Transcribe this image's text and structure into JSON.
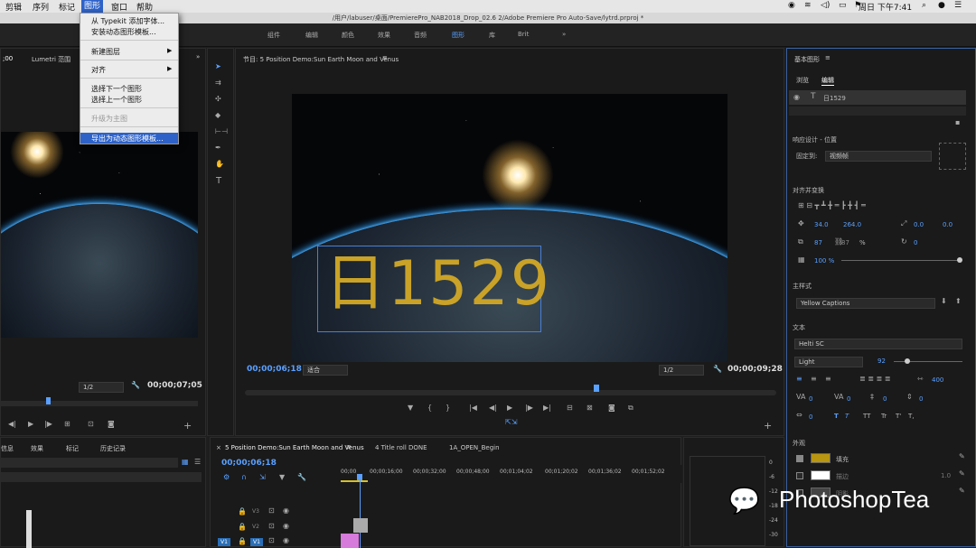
{
  "menubar": {
    "items": [
      "剪辑",
      "序列",
      "标记",
      "图形",
      "窗口",
      "帮助"
    ],
    "active_index": 3,
    "clock": "周日 下午7:41"
  },
  "titlebar": {
    "path": "/用户/labuser/桌面/PremierePro_NAB2018_Drop_02.6 2/Adobe Premiere Pro Auto-Save/lytrd.prproj *"
  },
  "workspace": {
    "tabs": [
      "组件",
      "编辑",
      "颜色",
      "效果",
      "音频",
      "图形",
      "库",
      "Brit"
    ],
    "active": "图形"
  },
  "dropdown": {
    "items": [
      "从 Typekit 添加字体...",
      "安装动态图形模板...",
      "新建图层",
      "对齐",
      "选择下一个图形",
      "选择上一个图形",
      "升级为主图",
      "导出为动态图形模板..."
    ]
  },
  "source_monitor": {
    "tab": "Lumetri 范围",
    "scale": "1/2",
    "timecode": "00;00;07;05"
  },
  "program_monitor": {
    "title": "节目: 5 Position Demo:Sun Earth Moon and Venus",
    "overlay_text": "日1529",
    "timecode_left": "00;00;06;18",
    "fit": "适合",
    "scale": "1/2",
    "timecode_right": "00;00;09;28",
    "text_color": "#c9a227"
  },
  "project_panel": {
    "tabs": [
      "信息",
      "效果",
      "标记",
      "历史记录"
    ]
  },
  "timeline": {
    "tabs": [
      "5 Position Demo:Sun Earth Moon and Venus",
      "4 Title roll DONE",
      "1A_OPEN_Begin"
    ],
    "timecode": "00;00;06;18",
    "ruler": [
      "00;00",
      "00;00;16;00",
      "00;00;32;00",
      "00;00;48;00",
      "00;01;04;02",
      "00;01;20;02",
      "00;01;36;02",
      "00;01;52;02"
    ],
    "tracks": [
      "V3",
      "V2",
      "V1"
    ],
    "v1_src": "V1"
  },
  "audio_meter": {
    "marks": [
      "0",
      "-6",
      "-12",
      "-18",
      "-24",
      "-30"
    ]
  },
  "essential_graphics": {
    "title": "基本图形",
    "tabs": [
      "浏览",
      "编辑"
    ],
    "active_tab": "编辑",
    "layer_name": "日1529",
    "responsive_label": "响应设计 - 位置",
    "pin_label": "固定到:",
    "pin_value": "视频帧",
    "align_label": "对齐并变换",
    "pos_x": "34.0",
    "pos_y": "264.0",
    "anchor_x": "0.0",
    "anchor_y": "0.0",
    "scale_w": "87",
    "scale_h": "87",
    "scale_unit": "%",
    "rotation": "0",
    "opacity": "100 %",
    "master_style_label": "主样式",
    "master_style_value": "Yellow Captions",
    "text_label": "文本",
    "font": "Helti SC",
    "font_style": "Light",
    "font_size": "92",
    "tracking": "400",
    "kerning": "0",
    "va": "0",
    "leading": "0",
    "baseline": "0",
    "tsume": "0",
    "caps": [
      "T",
      "T",
      "TT",
      "Tr",
      "T'",
      "T,"
    ],
    "appearance_label": "外观",
    "fill_label": "填充",
    "stroke_label": "描边",
    "stroke_width": "1.0",
    "shadow_label": "阴影",
    "fill_color": "#b8960f",
    "stroke_color": "#ffffff"
  },
  "watermark": "PhotoshopTea"
}
